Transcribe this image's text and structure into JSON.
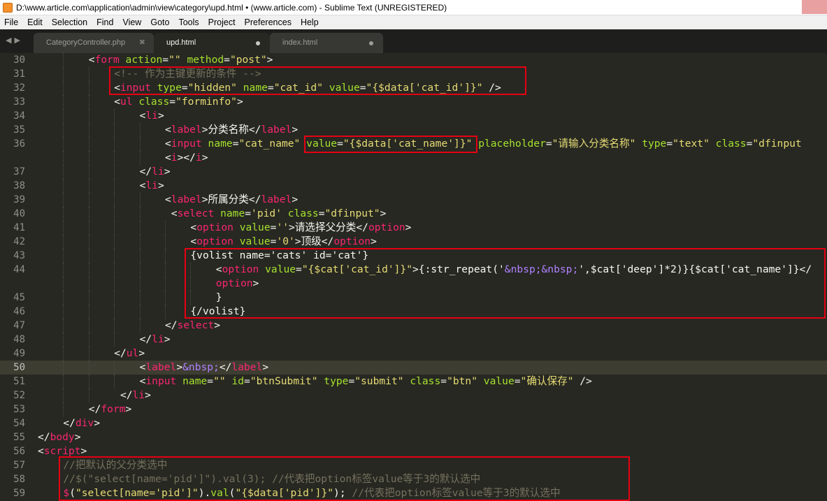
{
  "window": {
    "title": "D:\\www.article.com\\application\\admin\\view\\category\\upd.html • (www.article.com) - Sublime Text (UNREGISTERED)"
  },
  "menu": [
    "File",
    "Edit",
    "Selection",
    "Find",
    "View",
    "Goto",
    "Tools",
    "Project",
    "Preferences",
    "Help"
  ],
  "tabs": [
    {
      "label": "CategoryController.php",
      "state": "close",
      "active": false
    },
    {
      "label": "upd.html",
      "state": "dirty",
      "active": true
    },
    {
      "label": "index.html",
      "state": "dirty",
      "active": false
    }
  ],
  "colors": {
    "background": "#272822",
    "tag": "#f92672",
    "attribute": "#a6e22e",
    "string": "#e6db74",
    "comment": "#75715e",
    "entity": "#ae81ff",
    "annotation_box": "#e60012"
  },
  "highlighted_line": "50",
  "code_lines": [
    {
      "n": "30",
      "indent": 2,
      "t": [
        [
          "p",
          "<"
        ],
        [
          "t",
          "form"
        ],
        [
          "p",
          " "
        ],
        [
          "a",
          "action"
        ],
        [
          "p",
          "="
        ],
        [
          "s",
          "\"\""
        ],
        [
          "p",
          " "
        ],
        [
          "a",
          "method"
        ],
        [
          "p",
          "="
        ],
        [
          "s",
          "\"post\""
        ],
        [
          "p",
          ">"
        ]
      ]
    },
    {
      "n": "31",
      "indent": 3,
      "t": [
        [
          "c",
          "<!-- 作为主键更新的条件 -->"
        ]
      ]
    },
    {
      "n": "32",
      "indent": 3,
      "t": [
        [
          "p",
          "<"
        ],
        [
          "t",
          "input"
        ],
        [
          "p",
          " "
        ],
        [
          "a",
          "type"
        ],
        [
          "p",
          "="
        ],
        [
          "s",
          "\"hidden\""
        ],
        [
          "p",
          " "
        ],
        [
          "a",
          "name"
        ],
        [
          "p",
          "="
        ],
        [
          "s",
          "\"cat_id\""
        ],
        [
          "p",
          " "
        ],
        [
          "a",
          "value"
        ],
        [
          "p",
          "="
        ],
        [
          "s",
          "\"{$data['cat_id']}\""
        ],
        [
          "p",
          " />"
        ]
      ]
    },
    {
      "n": "33",
      "indent": 3,
      "t": [
        [
          "p",
          "<"
        ],
        [
          "t",
          "ul"
        ],
        [
          "p",
          " "
        ],
        [
          "a",
          "class"
        ],
        [
          "p",
          "="
        ],
        [
          "s",
          "\"forminfo\""
        ],
        [
          "p",
          ">"
        ]
      ]
    },
    {
      "n": "34",
      "indent": 4,
      "t": [
        [
          "p",
          "<"
        ],
        [
          "t",
          "li"
        ],
        [
          "p",
          ">"
        ]
      ]
    },
    {
      "n": "35",
      "indent": 5,
      "t": [
        [
          "p",
          "<"
        ],
        [
          "t",
          "label"
        ],
        [
          "p",
          ">分类名称</"
        ],
        [
          "t",
          "label"
        ],
        [
          "p",
          ">"
        ]
      ]
    },
    {
      "n": "36",
      "indent": 5,
      "t": [
        [
          "p",
          "<"
        ],
        [
          "t",
          "input"
        ],
        [
          "p",
          " "
        ],
        [
          "a",
          "name"
        ],
        [
          "p",
          "="
        ],
        [
          "s",
          "\"cat_name\""
        ],
        [
          "p",
          " "
        ],
        [
          "a",
          "value"
        ],
        [
          "p",
          "="
        ],
        [
          "s",
          "\"{$data['cat_name']}\""
        ],
        [
          "p",
          " "
        ],
        [
          "a",
          "placeholder"
        ],
        [
          "p",
          "="
        ],
        [
          "s",
          "\"请输入分类名称\""
        ],
        [
          "p",
          " "
        ],
        [
          "a",
          "type"
        ],
        [
          "p",
          "="
        ],
        [
          "s",
          "\"text\""
        ],
        [
          "p",
          " "
        ],
        [
          "a",
          "class"
        ],
        [
          "p",
          "="
        ],
        [
          "s",
          "\"dfinput"
        ]
      ]
    },
    {
      "n": "",
      "indent": 5,
      "t": [
        [
          "p",
          "<"
        ],
        [
          "t",
          "i"
        ],
        [
          "p",
          "></"
        ],
        [
          "t",
          "i"
        ],
        [
          "p",
          ">"
        ]
      ]
    },
    {
      "n": "37",
      "indent": 4,
      "t": [
        [
          "p",
          "</"
        ],
        [
          "t",
          "li"
        ],
        [
          "p",
          ">"
        ]
      ]
    },
    {
      "n": "38",
      "indent": 4,
      "t": [
        [
          "p",
          "<"
        ],
        [
          "t",
          "li"
        ],
        [
          "p",
          ">"
        ]
      ]
    },
    {
      "n": "39",
      "indent": 5,
      "t": [
        [
          "p",
          "<"
        ],
        [
          "t",
          "label"
        ],
        [
          "p",
          ">所属分类</"
        ],
        [
          "t",
          "label"
        ],
        [
          "p",
          ">"
        ]
      ]
    },
    {
      "n": "40",
      "indent": 5,
      "t": [
        [
          "p",
          " <"
        ],
        [
          "t",
          "select"
        ],
        [
          "p",
          " "
        ],
        [
          "a",
          "name"
        ],
        [
          "p",
          "="
        ],
        [
          "s",
          "'pid'"
        ],
        [
          "p",
          " "
        ],
        [
          "a",
          "class"
        ],
        [
          "p",
          "="
        ],
        [
          "s",
          "\"dfinput\""
        ],
        [
          "p",
          ">"
        ]
      ]
    },
    {
      "n": "41",
      "indent": 6,
      "t": [
        [
          "p",
          "<"
        ],
        [
          "t",
          "option"
        ],
        [
          "p",
          " "
        ],
        [
          "a",
          "value"
        ],
        [
          "p",
          "="
        ],
        [
          "s",
          "''"
        ],
        [
          "p",
          ">请选择父分类</"
        ],
        [
          "t",
          "option"
        ],
        [
          "p",
          ">"
        ]
      ]
    },
    {
      "n": "42",
      "indent": 6,
      "t": [
        [
          "p",
          "<"
        ],
        [
          "t",
          "option"
        ],
        [
          "p",
          " "
        ],
        [
          "a",
          "value"
        ],
        [
          "p",
          "="
        ],
        [
          "s",
          "'0'"
        ],
        [
          "p",
          ">顶级</"
        ],
        [
          "t",
          "option"
        ],
        [
          "p",
          ">"
        ]
      ]
    },
    {
      "n": "43",
      "indent": 6,
      "t": [
        [
          "p",
          "{volist name='cats' id='cat'}"
        ]
      ]
    },
    {
      "n": "44",
      "indent": 7,
      "t": [
        [
          "p",
          "<"
        ],
        [
          "t",
          "option"
        ],
        [
          "p",
          " "
        ],
        [
          "a",
          "value"
        ],
        [
          "p",
          "="
        ],
        [
          "s",
          "\"{$cat['cat_id']}\""
        ],
        [
          "p",
          ">{:str_repeat('"
        ],
        [
          "e",
          "&nbsp;&nbsp;"
        ],
        [
          "p",
          "',$cat['deep']*2)}{$cat['cat_name']}</"
        ]
      ]
    },
    {
      "n": "",
      "indent": 7,
      "t": [
        [
          "t",
          "option"
        ],
        [
          "p",
          ">"
        ]
      ]
    },
    {
      "n": "45",
      "indent": 7,
      "t": [
        [
          "p",
          "}"
        ]
      ]
    },
    {
      "n": "46",
      "indent": 6,
      "t": [
        [
          "p",
          "{/volist}"
        ]
      ]
    },
    {
      "n": "47",
      "indent": 5,
      "t": [
        [
          "p",
          "</"
        ],
        [
          "t",
          "select"
        ],
        [
          "p",
          ">"
        ]
      ]
    },
    {
      "n": "48",
      "indent": 4,
      "t": [
        [
          "p",
          "</"
        ],
        [
          "t",
          "li"
        ],
        [
          "p",
          ">"
        ]
      ]
    },
    {
      "n": "49",
      "indent": 3,
      "t": [
        [
          "p",
          "</"
        ],
        [
          "t",
          "ul"
        ],
        [
          "p",
          ">"
        ]
      ]
    },
    {
      "n": "50",
      "indent": 4,
      "t": [
        [
          "p",
          "<"
        ],
        [
          "t",
          "label"
        ],
        [
          "p",
          ">"
        ],
        [
          "e",
          "&nbsp;"
        ],
        [
          "p",
          "</"
        ],
        [
          "t",
          "label"
        ],
        [
          "p",
          ">"
        ]
      ]
    },
    {
      "n": "51",
      "indent": 4,
      "t": [
        [
          "p",
          "<"
        ],
        [
          "t",
          "input"
        ],
        [
          "p",
          " "
        ],
        [
          "a",
          "name"
        ],
        [
          "p",
          "="
        ],
        [
          "s",
          "\"\""
        ],
        [
          "p",
          " "
        ],
        [
          "a",
          "id"
        ],
        [
          "p",
          "="
        ],
        [
          "s",
          "\"btnSubmit\""
        ],
        [
          "p",
          " "
        ],
        [
          "a",
          "type"
        ],
        [
          "p",
          "="
        ],
        [
          "s",
          "\"submit\""
        ],
        [
          "p",
          " "
        ],
        [
          "a",
          "class"
        ],
        [
          "p",
          "="
        ],
        [
          "s",
          "\"btn\""
        ],
        [
          "p",
          " "
        ],
        [
          "a",
          "value"
        ],
        [
          "p",
          "="
        ],
        [
          "s",
          "\"确认保存\""
        ],
        [
          "p",
          " />"
        ]
      ]
    },
    {
      "n": "52",
      "indent": 3,
      "t": [
        [
          "p",
          " </"
        ],
        [
          "t",
          "li"
        ],
        [
          "p",
          ">"
        ]
      ]
    },
    {
      "n": "53",
      "indent": 2,
      "t": [
        [
          "p",
          "</"
        ],
        [
          "t",
          "form"
        ],
        [
          "p",
          ">"
        ]
      ]
    },
    {
      "n": "54",
      "indent": 1,
      "t": [
        [
          "p",
          "</"
        ],
        [
          "t",
          "div"
        ],
        [
          "p",
          ">"
        ]
      ]
    },
    {
      "n": "55",
      "indent": 0,
      "t": [
        [
          "p",
          "</"
        ],
        [
          "t",
          "body"
        ],
        [
          "p",
          ">"
        ]
      ]
    },
    {
      "n": "56",
      "indent": 0,
      "t": [
        [
          "p",
          "<"
        ],
        [
          "t",
          "script"
        ],
        [
          "p",
          ">"
        ]
      ]
    },
    {
      "n": "57",
      "indent": 1,
      "t": [
        [
          "c",
          "//把默认的父分类选中"
        ]
      ]
    },
    {
      "n": "58",
      "indent": 1,
      "t": [
        [
          "c",
          "//$(\"select[name='pid']\").val(3); //代表把option标签value等于3的默认选中"
        ]
      ]
    },
    {
      "n": "59",
      "indent": 1,
      "t": [
        [
          "t",
          "$"
        ],
        [
          "p",
          "("
        ],
        [
          "s",
          "\"select[name='pid']\""
        ],
        [
          "p",
          ")."
        ],
        [
          "a",
          "val"
        ],
        [
          "p",
          "("
        ],
        [
          "s",
          "\"{$data['pid']}\""
        ],
        [
          "p",
          ");"
        ],
        [
          "c",
          " //代表把option标签value等于3的默认选中"
        ]
      ]
    }
  ]
}
